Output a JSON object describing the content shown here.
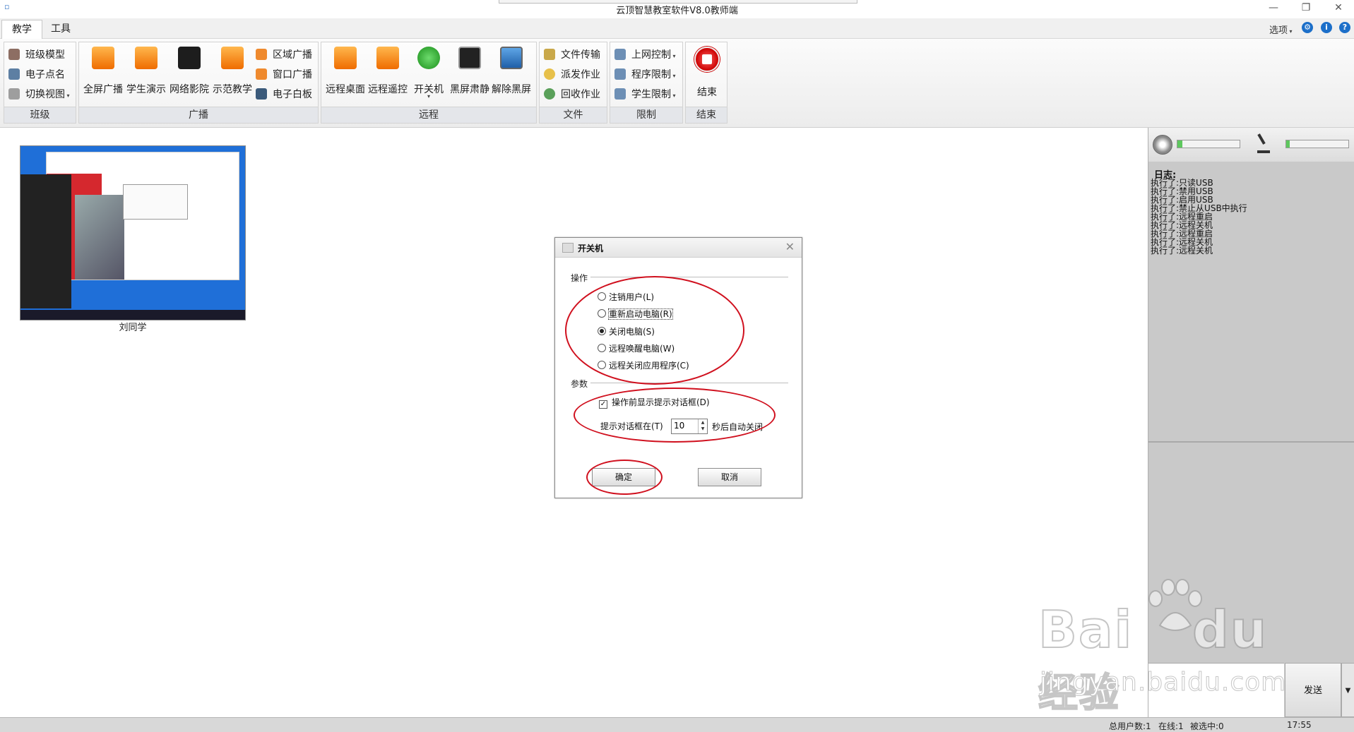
{
  "window": {
    "title": "云顶智慧教室软件V8.0教师端",
    "app_icon": "app-icon"
  },
  "tabs": [
    {
      "label": "教学",
      "active": true
    },
    {
      "label": "工具",
      "active": false
    }
  ],
  "topright": {
    "options_label": "选项"
  },
  "ribbon": {
    "class_group": {
      "label": "班级",
      "items": [
        "班级模型",
        "电子点名",
        "切换视图"
      ]
    },
    "broadcast_group": {
      "label": "广播",
      "big": [
        "全屏广播",
        "学生演示",
        "网络影院",
        "示范教学"
      ],
      "small": [
        "区域广播",
        "窗口广播",
        "电子白板"
      ]
    },
    "remote_group": {
      "label": "远程",
      "big": [
        "远程桌面",
        "远程遥控",
        "开关机",
        "黑屏肃静",
        "解除黑屏"
      ]
    },
    "file_group": {
      "label": "文件",
      "items": [
        "文件传输",
        "派发作业",
        "回收作业"
      ]
    },
    "limit_group": {
      "label": "限制",
      "items": [
        "上网控制",
        "程序限制",
        "学生限制"
      ]
    },
    "end_group": {
      "label": "结束",
      "big": "结束"
    }
  },
  "student": {
    "name": "刘同学"
  },
  "dialog": {
    "title": "开关机",
    "operation_legend": "操作",
    "options": [
      {
        "label": "注销用户(L)",
        "checked": false
      },
      {
        "label": "重新启动电脑(R)",
        "checked": false
      },
      {
        "label": "关闭电脑(S)",
        "checked": true
      },
      {
        "label": "远程唤醒电脑(W)",
        "checked": false
      },
      {
        "label": "远程关闭应用程序(C)",
        "checked": false
      }
    ],
    "param_legend": "参数",
    "show_prompt_label": "操作前显示提示对话框(D)",
    "show_prompt_checked": true,
    "prompt_prefix": "提示对话框在(T)",
    "prompt_seconds": "10",
    "prompt_suffix": "秒后自动关闭",
    "ok_label": "确定",
    "cancel_label": "取消"
  },
  "side": {
    "speaker_level": 0.08,
    "mic_level": 0.06,
    "log_title": "日志:",
    "log_lines": [
      "执行了:只读USB",
      "执行了:禁用USB",
      "执行了:启用USB",
      "执行了:禁止从USB中执行",
      "执行了:远程重启",
      "执行了:远程关机",
      "执行了:远程重启",
      "执行了:远程关机",
      "执行了:远程关机"
    ],
    "send_label": "发送"
  },
  "status": {
    "total": "总用户数:1",
    "online": "在线:1",
    "selected": "被选中:0",
    "time": "17:55"
  },
  "watermark": {
    "brand": "Bai",
    "brand2": "du",
    "cn": "经验",
    "url": "jingyan.baidu.com"
  },
  "colors": {
    "annotation_red": "#d0101e",
    "ribbon_group_bg": "#e4e6ea",
    "panel_gray": "#c9c9c9"
  }
}
